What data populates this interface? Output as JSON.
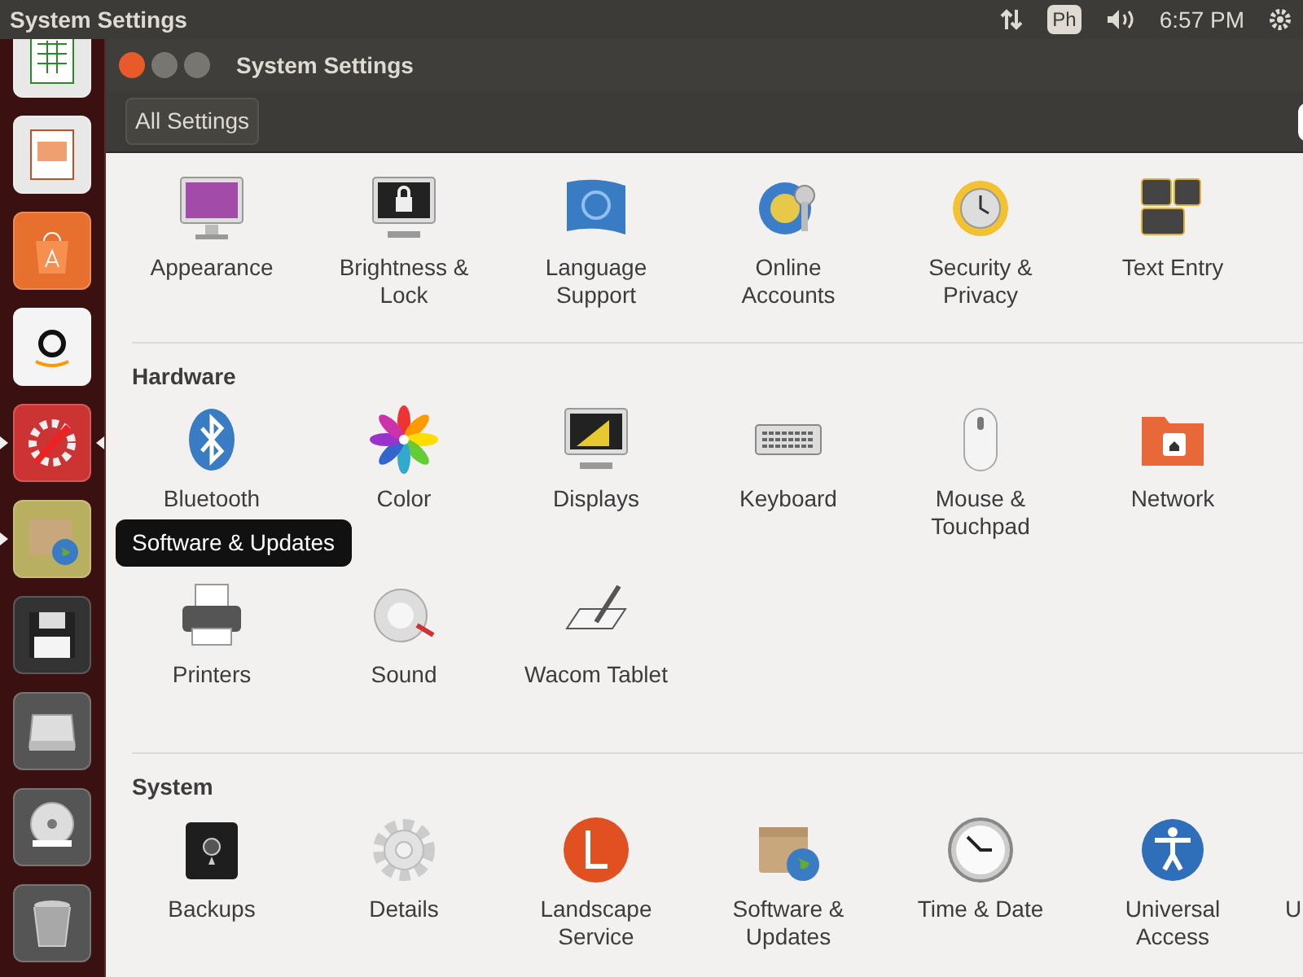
{
  "top_bar": {
    "title": "System Settings",
    "keyboard_layout": "Ph",
    "time": "6:57 PM"
  },
  "launcher": {
    "items": [
      {
        "kind": "spreadsheet",
        "running": false,
        "focused": false
      },
      {
        "kind": "presentation",
        "running": false,
        "focused": false
      },
      {
        "kind": "store",
        "running": false,
        "focused": false
      },
      {
        "kind": "amazon",
        "running": false,
        "focused": false
      },
      {
        "kind": "settings",
        "running": true,
        "focused": true
      },
      {
        "kind": "updates",
        "running": true,
        "focused": false
      },
      {
        "kind": "floppy",
        "running": false,
        "focused": false
      },
      {
        "kind": "drive",
        "running": false,
        "focused": false
      },
      {
        "kind": "dvd",
        "running": false,
        "focused": false
      },
      {
        "kind": "trash",
        "running": false,
        "focused": false
      }
    ],
    "tooltip": "Software & Updates"
  },
  "window": {
    "title": "System Settings",
    "toolbar": {
      "all_settings": "All Settings"
    }
  },
  "sections": [
    {
      "items": [
        {
          "kind": "appearance",
          "label": "Appearance"
        },
        {
          "kind": "brightness",
          "label": "Brightness & Lock"
        },
        {
          "kind": "language",
          "label": "Language Support"
        },
        {
          "kind": "online",
          "label": "Online Accounts"
        },
        {
          "kind": "security",
          "label": "Security & Privacy"
        },
        {
          "kind": "textentry",
          "label": "Text Entry"
        }
      ]
    },
    {
      "title": "Hardware",
      "items": [
        {
          "kind": "bluetooth",
          "label": "Bluetooth"
        },
        {
          "kind": "color",
          "label": "Color"
        },
        {
          "kind": "displays",
          "label": "Displays"
        },
        {
          "kind": "keyboard",
          "label": "Keyboard"
        },
        {
          "kind": "mouse",
          "label": "Mouse & Touchpad"
        },
        {
          "kind": "network",
          "label": "Network"
        },
        {
          "kind": "printers",
          "label": "Printers"
        },
        {
          "kind": "sound",
          "label": "Sound"
        },
        {
          "kind": "wacom",
          "label": "Wacom Tablet"
        }
      ]
    },
    {
      "title": "System",
      "items": [
        {
          "kind": "backups",
          "label": "Backups"
        },
        {
          "kind": "details",
          "label": "Details"
        },
        {
          "kind": "landscape",
          "label": "Landscape Service"
        },
        {
          "kind": "software",
          "label": "Software & Updates"
        },
        {
          "kind": "timedate",
          "label": "Time & Date"
        },
        {
          "kind": "universal",
          "label": "Universal Access"
        },
        {
          "kind": "partial",
          "label": "U"
        }
      ]
    }
  ]
}
